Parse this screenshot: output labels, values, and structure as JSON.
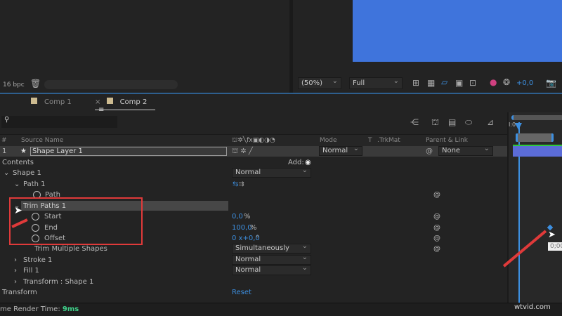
{
  "viewer": {
    "bpc": "16 bpc",
    "zoom": "(50%)",
    "resolution": "Full",
    "exposure": "+0,0",
    "comp_color": "#3f74dc"
  },
  "tabs": [
    {
      "label": "Comp 1",
      "active": false
    },
    {
      "label": "Comp 2",
      "active": true
    }
  ],
  "columns": {
    "num": "#",
    "source_name": "Source Name",
    "mode": "Mode",
    "t": "T",
    "trkmat": ".TrkMat",
    "parent": "Parent & Link"
  },
  "layer": {
    "index": "1",
    "name": "Shape Layer 1",
    "mode": "Normal",
    "parent": "None"
  },
  "tree": {
    "contents": "Contents",
    "add": "Add:",
    "shape1": "Shape 1",
    "shape1_mode": "Normal",
    "path1": "Path 1",
    "path": "Path",
    "trim": "Trim Paths 1",
    "start": "Start",
    "start_val": "0,0",
    "start_unit": "%",
    "end": "End",
    "end_val": "100,0",
    "end_unit": "%",
    "offset": "Offset",
    "offset_val": "0 x+0,0",
    "offset_unit": "°",
    "trim_multi": "Trim Multiple Shapes",
    "trim_multi_val": "Simultaneously",
    "stroke": "Stroke 1",
    "stroke_mode": "Normal",
    "fill": "Fill 1",
    "fill_mode": "Normal",
    "transform_shape": "Transform : Shape 1",
    "transform": "Transform",
    "reset": "Reset"
  },
  "footer": {
    "label": "me Render Time:",
    "value": "9ms"
  },
  "timeline": {
    "time": "0;00",
    "ruler": "I:0",
    "tooltip": "0;00",
    "watermark": "wtvid.com"
  },
  "colors": {
    "accent": "#3d8fe0",
    "highlight": "#e03a3a",
    "green": "#2ec93a"
  }
}
